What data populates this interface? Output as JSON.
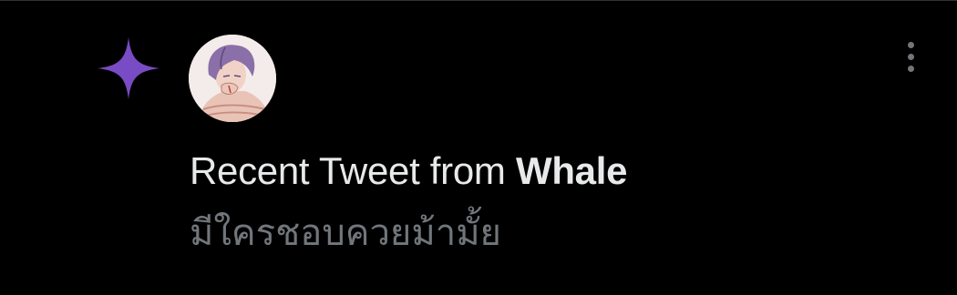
{
  "notification": {
    "type_icon": "sparkle-icon",
    "avatar_icon": "user-avatar",
    "more_icon": "more-vertical-icon",
    "headline_prefix": "Recent Tweet from ",
    "user_name": "Whale",
    "tweet_text": "มีใครชอบควยม้ามั้ย"
  },
  "colors": {
    "background": "#000000",
    "sparkle": "#794bc4",
    "primary_text": "#e7e9ea",
    "secondary_text": "#71767b",
    "divider": "#2f3336"
  }
}
